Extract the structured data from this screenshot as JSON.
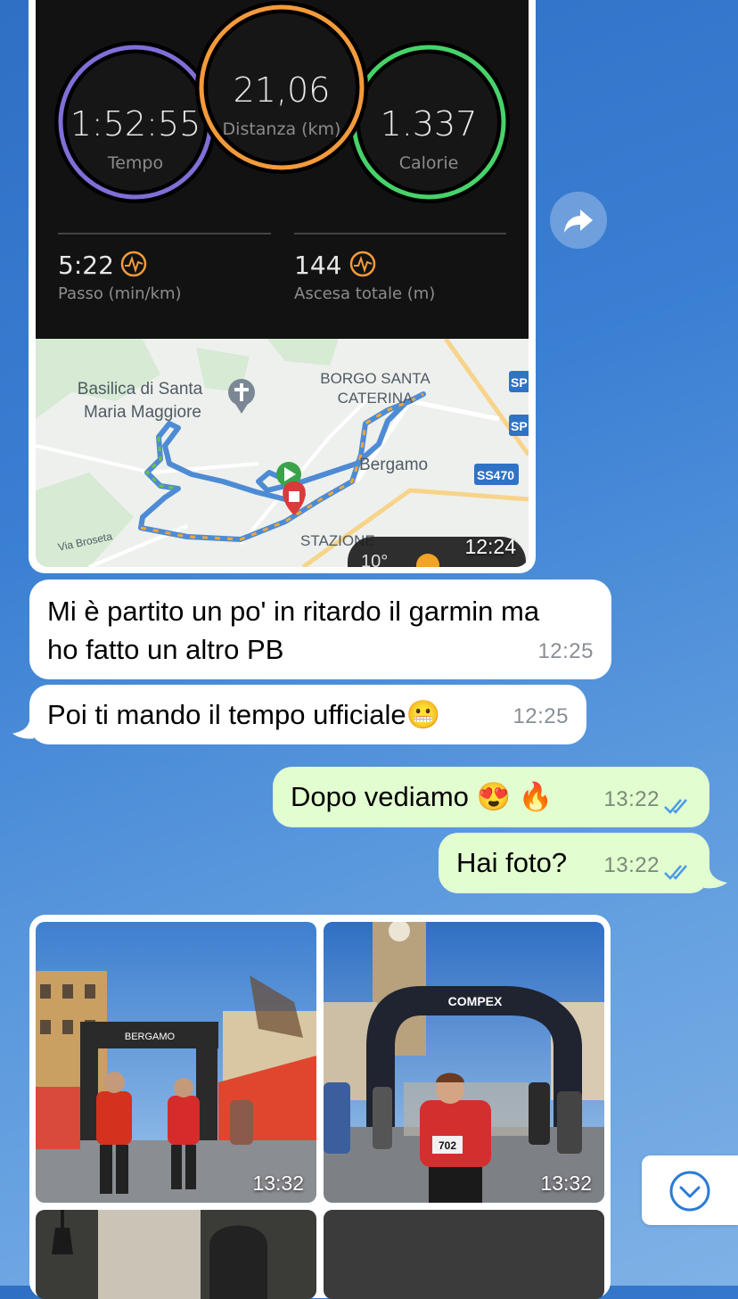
{
  "garmin": {
    "rings": [
      {
        "value": "1:52:55",
        "label": "Tempo",
        "color": "#7f6fd6"
      },
      {
        "value": "21,06",
        "label": "Distanza (km)",
        "color": "#f39a3b"
      },
      {
        "value": "1.337",
        "label": "Calorie",
        "color": "#47d26a"
      }
    ],
    "stats": [
      {
        "value": "5:22",
        "label": "Passo (min/km)"
      },
      {
        "value": "144",
        "label": "Ascesa totale (m)"
      }
    ]
  },
  "map": {
    "labels": {
      "basilica": [
        "Basilica di Santa",
        "Maria Maggiore"
      ],
      "borgo": [
        "BORGO SANTA",
        "CATERINA"
      ],
      "city": "Bergamo",
      "station": "STAZIONE",
      "street": "Via Broseta",
      "road1": "SP",
      "road2": "SP",
      "road3": "SS470",
      "temperature": "10°"
    }
  },
  "messages": {
    "image_time": "12:24",
    "m1": {
      "text_line1": "Mi è partito un po' in ritardo il garmin ma",
      "text_line2": "ho fatto un altro PB",
      "time": "12:25"
    },
    "m2": {
      "text": "Poi ti mando il tempo ufficiale😬",
      "time": "12:25"
    },
    "m3": {
      "text": "Dopo vediamo 😍 🔥",
      "time": "13:22"
    },
    "m4": {
      "text": "Hai foto?",
      "time": "13:22"
    }
  },
  "photos": {
    "p1_time": "13:32",
    "p2_time": "13:32",
    "arch_brand": "COMPEX",
    "bib": "702",
    "banner": "BERGAMO"
  },
  "colors": {
    "incoming": "#ffffff",
    "outgoing": "#e2fdcf",
    "ticks": "#4a9be8"
  }
}
